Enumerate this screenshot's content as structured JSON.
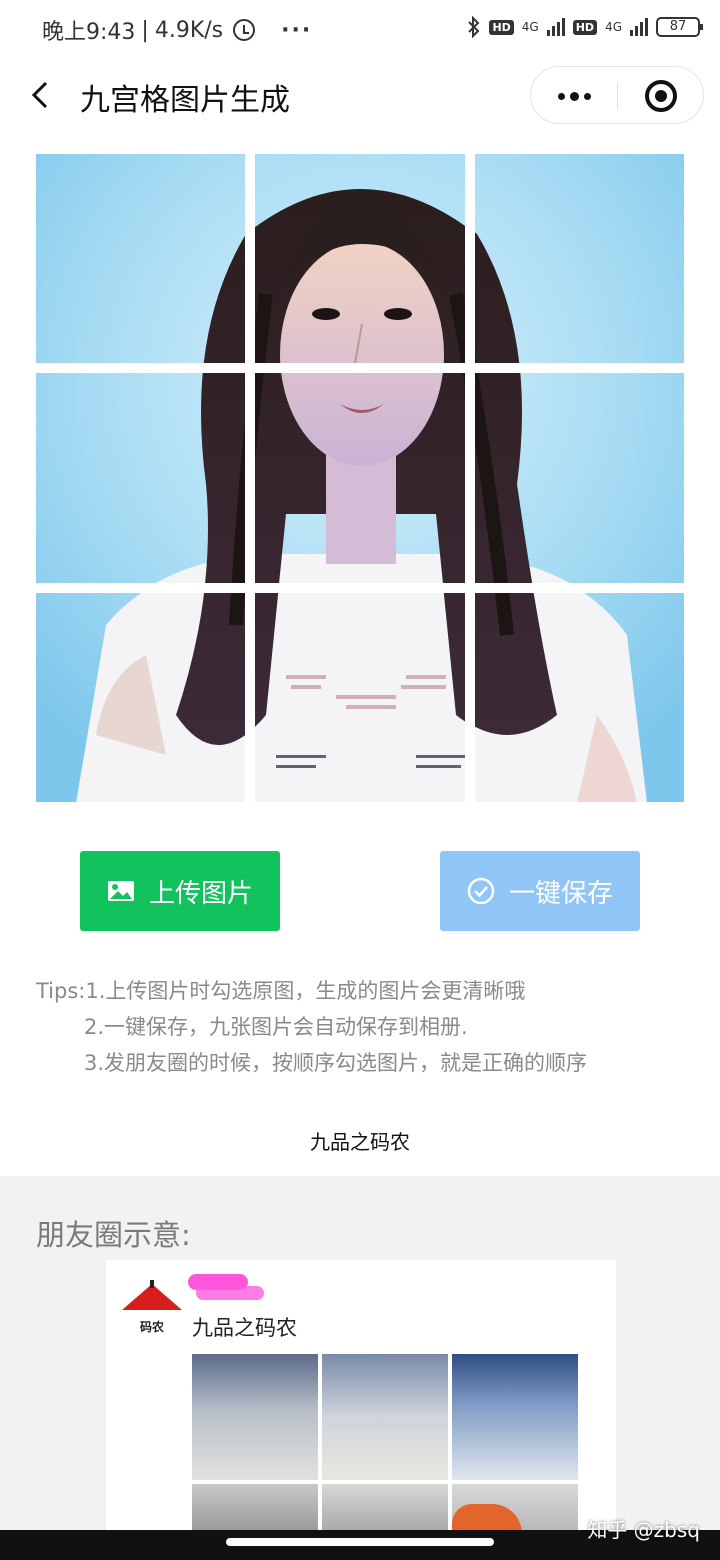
{
  "status_bar": {
    "time": "晚上9:43",
    "network_speed": "4.9K/s",
    "more": "···",
    "hd1": "HD",
    "net1": "4G",
    "hd2": "HD",
    "net2": "4G",
    "battery": "87"
  },
  "nav": {
    "title": "九宫格图片生成"
  },
  "buttons": {
    "upload_label": "上传图片",
    "save_label": "一键保存"
  },
  "tips": {
    "line1": "Tips:1.上传图片时勾选原图，生成的图片会更清晰哦",
    "line2": "2.一键保存，九张图片会自动保存到相册.",
    "line3": "3.发朋友圈的时候，按顺序勾选图片，就是正确的顺序"
  },
  "author": "九品之码农",
  "preview": {
    "title": "朋友圈示意:",
    "logo_text": "码农",
    "poster_name": "九品之码农"
  },
  "watermark": "知乎 @zbsq",
  "colors": {
    "upload_button": "#12c25d",
    "save_button": "#8fc6f6",
    "tips_text": "#8a8a8a",
    "preview_bg": "#f2f2f2"
  }
}
